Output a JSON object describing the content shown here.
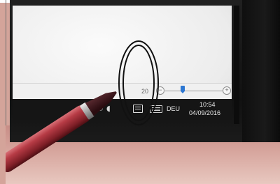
{
  "statusbar": {
    "zoom_percent": "20",
    "zoom_minus": "−",
    "zoom_plus": "+"
  },
  "taskbar": {
    "language": "DEU",
    "time": "10:54",
    "date": "04/09/2016"
  }
}
